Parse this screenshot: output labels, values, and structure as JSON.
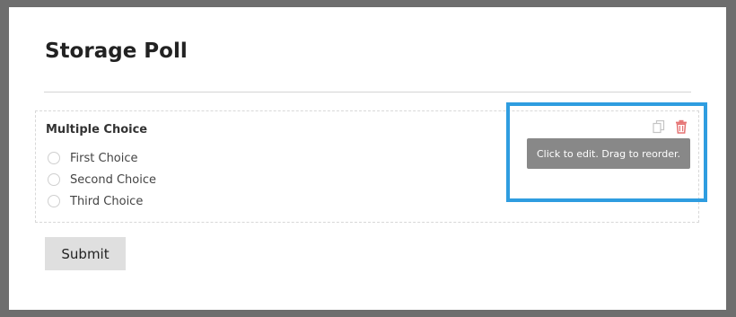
{
  "form": {
    "title": "Storage Poll",
    "submit_label": "Submit"
  },
  "field": {
    "label": "Multiple Choice",
    "choices": [
      {
        "label": "First Choice"
      },
      {
        "label": "Second Choice"
      },
      {
        "label": "Third Choice"
      }
    ],
    "actions": {
      "duplicate_icon": "duplicate-icon",
      "delete_icon": "trash-icon",
      "tooltip": "Click to edit. Drag to reorder."
    }
  },
  "colors": {
    "highlight": "#2f9de0",
    "delete": "#e57373",
    "tooltip_bg": "#888888"
  }
}
